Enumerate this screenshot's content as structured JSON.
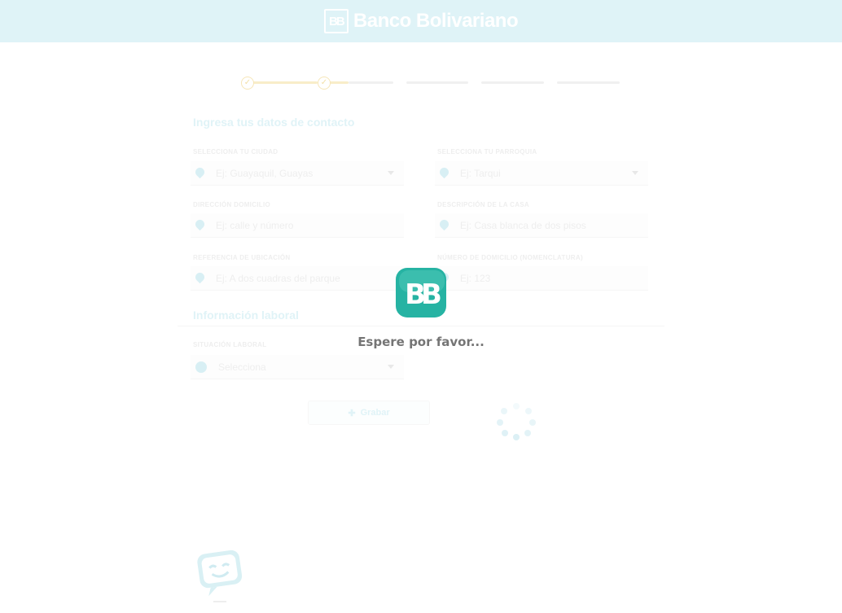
{
  "header": {
    "logo_mark": "BB",
    "brand_name": "Banco Bolivariano"
  },
  "stepper": {
    "completed_steps": 2,
    "total_steps": 5,
    "check_symbol": "✓"
  },
  "form": {
    "contact_title": "Ingresa tus datos de contacto",
    "fields": {
      "province": {
        "label": "Selecciona tu ciudad",
        "value": "Ej: Guayaquil, Guayas"
      },
      "parish": {
        "label": "Selecciona tu parroquia",
        "value": "Ej: Tarqui"
      },
      "address": {
        "label": "Dirección domicilio",
        "value": "Ej: calle y número"
      },
      "reference": {
        "label": "Descripción de la casa",
        "value": "Ej: Casa blanca de dos pisos"
      },
      "neighborhood": {
        "label": "Referencia de ubicación",
        "value": "Ej: A dos cuadras del parque"
      },
      "house_number": {
        "label": "Número de domicilio (nomenclatura)",
        "value": "Ej: 123"
      }
    },
    "work_title": "Información laboral",
    "work_field": {
      "label": "Situación laboral",
      "value": "Selecciona"
    },
    "save_label": "Grabar"
  },
  "overlay": {
    "logo_mark": "BB",
    "message": "Espere por favor..."
  },
  "colors": {
    "header_bg": "#dff3f7",
    "brand_teal": "#26b3a3",
    "overlay_text": "#757575",
    "progress_done": "#f8edc9"
  },
  "icons": {
    "pin": "location-pin-icon",
    "caret": "chevron-down-icon",
    "person": "person-icon",
    "plus": "plus-icon",
    "chat": "chat-bot-icon"
  }
}
